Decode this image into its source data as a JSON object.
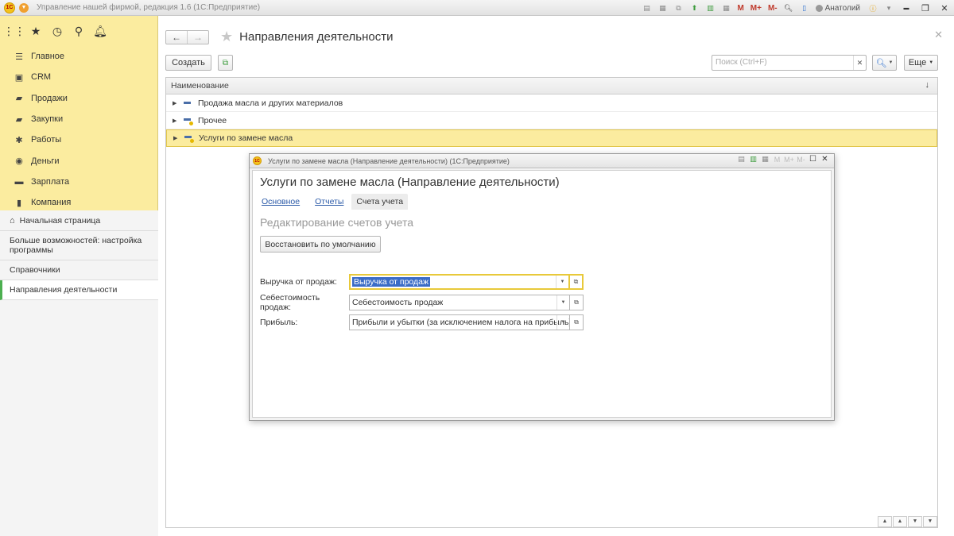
{
  "titlebar": {
    "logo": "1С",
    "title": "Управление нашей фирмой, редакция 1.6  (1С:Предприятие)",
    "m": "M",
    "m_plus": "M+",
    "m_minus": "M-",
    "user": "Анатолий",
    "minimize": "▬",
    "restore": "❐",
    "close": "✕"
  },
  "sidebar": {
    "sections": [
      {
        "label": "Главное",
        "icon": "list-icon"
      },
      {
        "label": "CRM",
        "icon": "crm-icon"
      },
      {
        "label": "Продажи",
        "icon": "sales-icon"
      },
      {
        "label": "Закупки",
        "icon": "purchases-icon"
      },
      {
        "label": "Работы",
        "icon": "works-icon"
      },
      {
        "label": "Деньги",
        "icon": "money-icon"
      },
      {
        "label": "Зарплата",
        "icon": "salary-icon"
      },
      {
        "label": "Компания",
        "icon": "company-icon"
      }
    ],
    "lower": {
      "home": "Начальная страница",
      "more": "Больше возможностей: настройка программы",
      "catalogs": "Справочники",
      "current": "Направления деятельности"
    }
  },
  "main": {
    "title": "Направления деятельности",
    "toolbar": {
      "create": "Создать",
      "search_placeholder": "Поиск (Ctrl+F)",
      "more": "Еще"
    },
    "table": {
      "column": "Наименование",
      "rows": [
        {
          "label": "Продажа масла и других материалов",
          "selected": false
        },
        {
          "label": "Прочее",
          "selected": false
        },
        {
          "label": "Услуги по замене масла",
          "selected": true
        }
      ]
    }
  },
  "dialog": {
    "window_title": "Услуги по замене масла (Направление деятельности)  (1С:Предприятие)",
    "heading": "Услуги по замене масла (Направление деятельности)",
    "tabs": [
      "Основное",
      "Отчеты",
      "Счета учета"
    ],
    "subheading": "Редактирование счетов учета",
    "restore_button": "Восстановить по умолчанию",
    "fields": [
      {
        "label": "Выручка от продаж:",
        "value": "Выручка от продаж"
      },
      {
        "label": "Себестоимость продаж:",
        "value": "Себестоимость продаж"
      },
      {
        "label": "Прибыль:",
        "value": "Прибыли и убытки (за исключением налога на прибыль)"
      }
    ]
  },
  "colors": {
    "sidebar_bg": "#fbec9f",
    "selection": "#fbec9f",
    "focus_border": "#e8c93a",
    "link": "#2b5aa8",
    "active_nav": "#4caf50"
  }
}
